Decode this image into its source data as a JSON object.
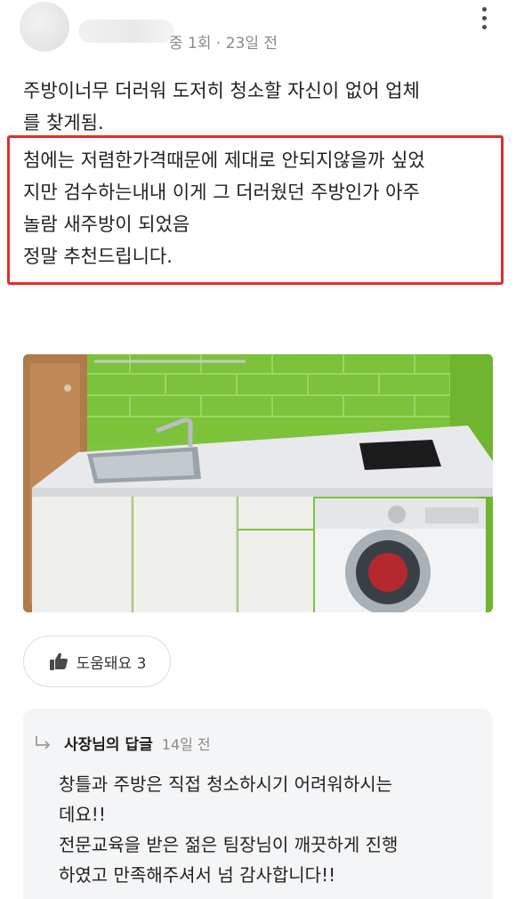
{
  "header": {
    "meta_text": "중 1회 · 23일 전"
  },
  "review": {
    "intro_lines": [
      "주방이너무 더러워 도저히 청소할 자신이 없어 업체",
      "를 찾게됨."
    ],
    "highlighted_lines": [
      "첨에는 저렴한가격때문에 제대로 안되지않을까 싶었",
      "지만 검수하는내내 이게 그 더러웠던 주방인가 아주",
      "놀람 새주방이 되었음",
      "정말 추천드립니다."
    ]
  },
  "helpful_button": {
    "label": "도움돼요 3"
  },
  "owner_reply": {
    "author": "사장님의 답글",
    "date": "14일 전",
    "lines": [
      "창틀과 주방은 직접 청소하시기 어려워하시는",
      "데요!!",
      "전문교육을 받은 젊은 팀장님이 깨끗하게 진행",
      "하였고 만족해주셔서 넘 감사합니다!!"
    ]
  },
  "icons": [
    "more-vertical-icon",
    "thumbs-up-icon",
    "reply-arrow-icon"
  ],
  "colors": {
    "highlight_border": "#e52a2a",
    "reply_background": "#f4f5f7",
    "tile_green": "#7fc43a"
  }
}
